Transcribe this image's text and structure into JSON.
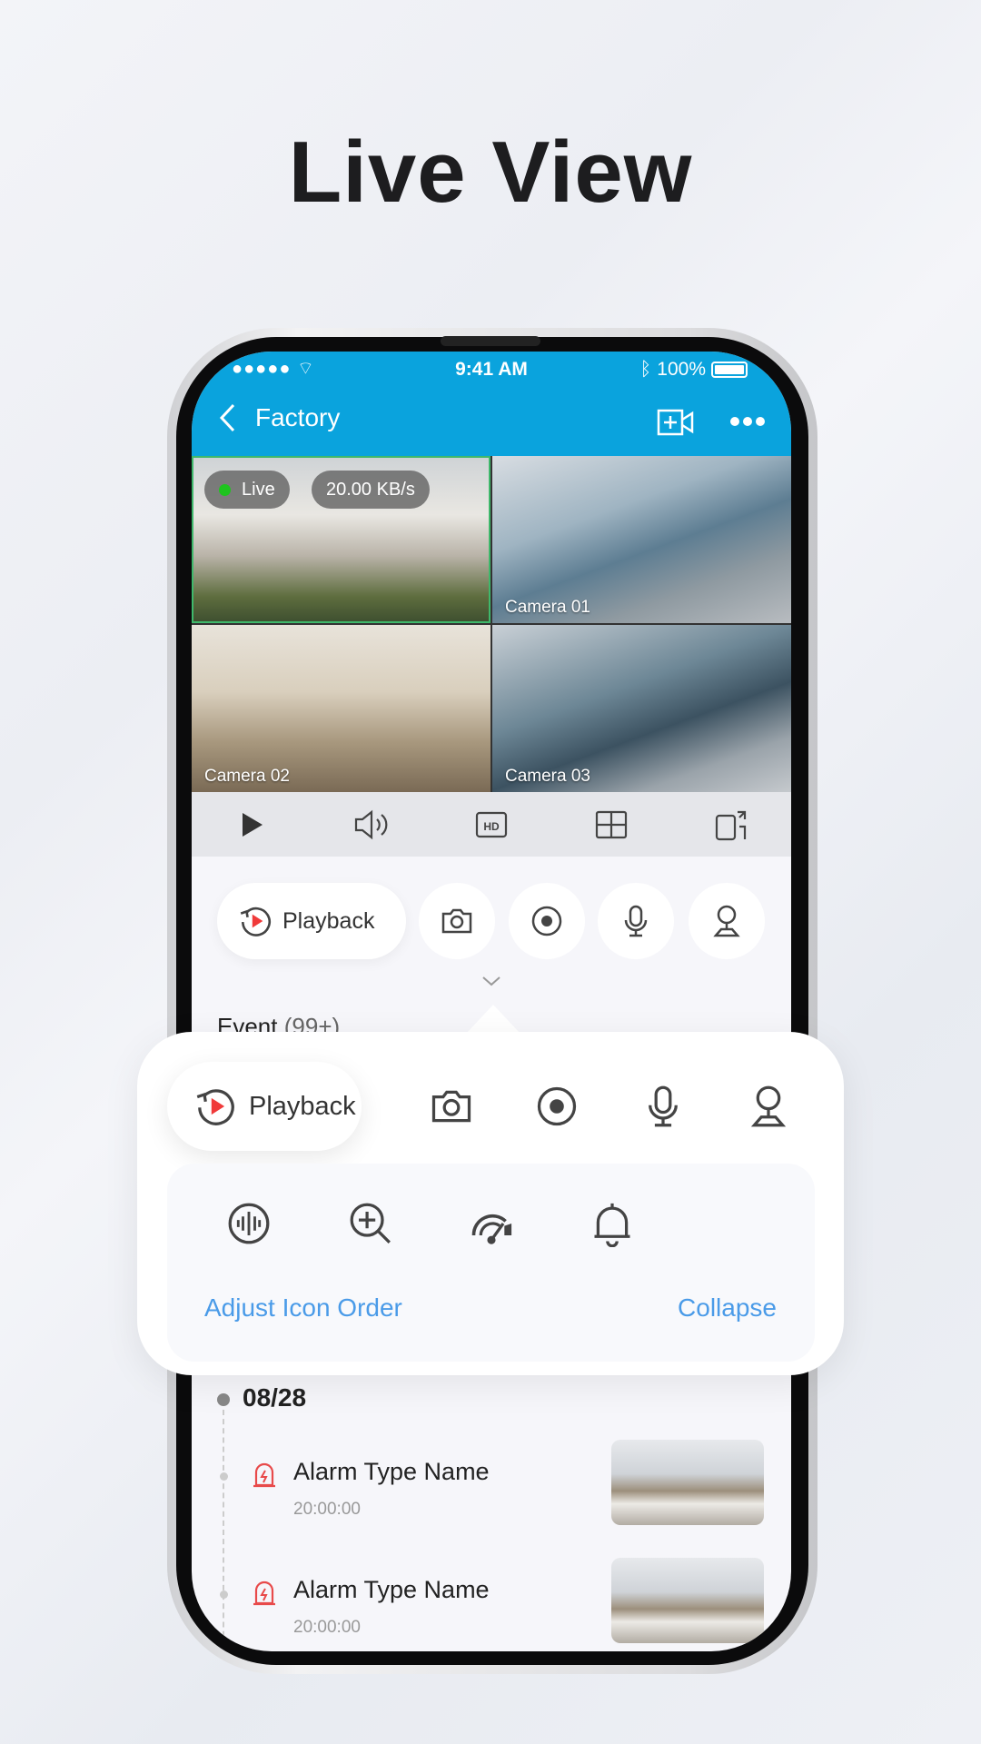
{
  "headline": "Live View",
  "status_bar": {
    "signal": "●●●●●",
    "time": "9:41 AM",
    "battery": "100%"
  },
  "nav": {
    "title": "Factory",
    "back_icon": "chevron-left-icon",
    "add_camera_icon": "video-plus-icon",
    "more_icon": "more-horizontal-icon"
  },
  "cameras": {
    "live_label": "Live",
    "bitrate": "20.00 KB/s",
    "tiles": [
      {
        "label": ""
      },
      {
        "label": "Camera 01"
      },
      {
        "label": "Camera 02"
      },
      {
        "label": "Camera 03"
      }
    ]
  },
  "toolbar": [
    "play-icon",
    "volume-icon",
    "hd-icon",
    "grid-layout-icon",
    "rotate-screen-icon"
  ],
  "actions": {
    "playback_label": "Playback",
    "icons": [
      "camera-icon",
      "record-icon",
      "microphone-icon",
      "ptz-icon"
    ]
  },
  "event": {
    "label": "Event",
    "count": "(99+)"
  },
  "popup": {
    "playback_label": "Playback",
    "row1_icons": [
      "camera-icon",
      "record-icon",
      "microphone-icon",
      "ptz-icon"
    ],
    "row2_icons": [
      "audio-wave-icon",
      "zoom-in-icon",
      "speed-gauge-icon",
      "bell-icon"
    ],
    "adjust_label": "Adjust Icon Order",
    "collapse_label": "Collapse",
    "link_color": "#4a9be8"
  },
  "timeline": {
    "date": "08/28",
    "alarms": [
      {
        "name": "Alarm Type Name",
        "time": "20:00:00"
      },
      {
        "name": "Alarm Type Name",
        "time": "20:00:00"
      }
    ]
  },
  "colors": {
    "brand": "#0aa3dd",
    "live_dot": "#1ec41e",
    "alarm": "#e84a4a",
    "playback_play": "#f03a3a"
  }
}
